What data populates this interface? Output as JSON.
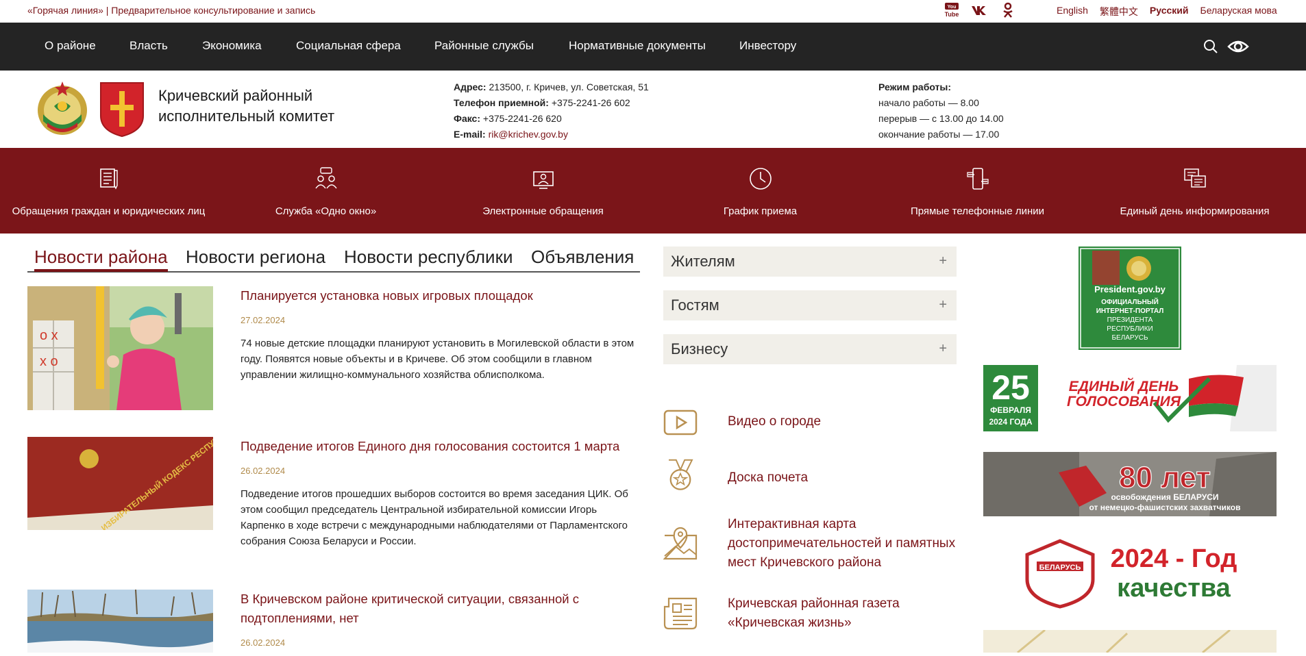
{
  "topbar": {
    "hotline": "«Горячая линия» | Предварительное консультирование и запись",
    "social": [
      "youtube-icon",
      "vk-icon",
      "odnoklassniki-icon"
    ],
    "languages": [
      {
        "label": "English",
        "active": false
      },
      {
        "label": "繁體中文",
        "active": false
      },
      {
        "label": "Русский",
        "active": true
      },
      {
        "label": "Беларуская мова",
        "active": false
      }
    ]
  },
  "nav": {
    "items": [
      "О районе",
      "Власть",
      "Экономика",
      "Социальная сфера",
      "Районные службы",
      "Нормативные документы",
      "Инвестору"
    ]
  },
  "header": {
    "org_name_1": "Кричевский районный",
    "org_name_2": "исполнительный комитет",
    "address_label": "Адрес:",
    "address": "213500, г. Кричев, ул. Советская, 51",
    "phone_label": "Телефон приемной:",
    "phone": "+375-2241-26 602",
    "fax_label": "Факс:",
    "fax": "+375-2241-26 620",
    "email_label": "E-mail:",
    "email": "rik@krichev.gov.by",
    "hours_title": "Режим работы:",
    "hours_1": "начало работы — 8.00",
    "hours_2": "перерыв — с 13.00 до 14.00",
    "hours_3": "окончание работы — 17.00"
  },
  "services": [
    {
      "label": "Обращения граждан и юридических лиц",
      "icon": "document-pen-icon"
    },
    {
      "label": "Служба «Одно окно»",
      "icon": "people-chat-icon"
    },
    {
      "label": "Электронные обращения",
      "icon": "computer-user-icon"
    },
    {
      "label": "График приема",
      "icon": "clock-icon"
    },
    {
      "label": "Прямые телефонные линии",
      "icon": "phone-icon"
    },
    {
      "label": "Единый день информирования",
      "icon": "info-cards-icon"
    }
  ],
  "news_tabs": [
    {
      "label": "Новости района",
      "active": true
    },
    {
      "label": "Новости региона",
      "active": false
    },
    {
      "label": "Новости республики",
      "active": false
    },
    {
      "label": "Объявления",
      "active": false
    }
  ],
  "news": [
    {
      "title": "Планируется установка новых игровых площадок",
      "date": "27.02.2024",
      "text": "74 новые детские площадки планируют установить в Могилевской области в этом году. Появятся новые объекты и в Кричеве. Об этом сообщили в главном управлении жилищно-коммунального хозяйства облисполкома."
    },
    {
      "title": "Подведение итогов Единого дня голосования состоится 1 марта",
      "date": "26.02.2024",
      "text": "Подведение итогов прошедших выборов состоится во время заседания ЦИК. Об этом сообщил председатель Центральной избирательной комиссии Игорь Карпенко в ходе встречи с международными наблюдателями от Парламентского собрания Союза Беларуси и России.",
      "book_text": "ИЗБИРАТЕЛЬНЫЙ КОДЕКС РЕСПУБЛИКИ БЕЛАРУСЬ"
    },
    {
      "title": "В Кричевском районе критической ситуации, связанной с подтоплениями, нет",
      "date": "26.02.2024",
      "text": ""
    }
  ],
  "accordion": [
    {
      "label": "Жителям",
      "icon": "plus-icon",
      "sign": "+"
    },
    {
      "label": "Гостям",
      "icon": "plus-icon",
      "sign": "+"
    },
    {
      "label": "Бизнесу",
      "icon": "plus-icon",
      "sign": "+"
    }
  ],
  "quick_links": [
    {
      "label": "Видео о городе",
      "icon": "video-play-icon"
    },
    {
      "label": "Доска почета",
      "icon": "medal-icon"
    },
    {
      "label": "Интерактивная карта достопримечательностей и памятных мест Кричевского района",
      "icon": "map-pin-icon"
    },
    {
      "label": "Кричевская районная газета «Кричевская жизнь»",
      "icon": "newspaper-icon"
    }
  ],
  "banners": {
    "president": {
      "line1": "President.gov.by",
      "line2": "ОФИЦИАЛЬНЫЙ",
      "line3": "ИНТЕРНЕТ-ПОРТАЛ",
      "line4": "ПРЕЗИДЕНТА",
      "line5": "РЕСПУБЛИКИ",
      "line6": "БЕЛАРУСЬ"
    },
    "vote": {
      "day": "25",
      "month": "ФЕВРАЛЯ",
      "year": "2024 ГОДА",
      "title1": "ЕДИНЫЙ ДЕНЬ",
      "title2": "ГОЛОСОВАНИЯ"
    },
    "liberation": {
      "big": "80 лет",
      "l1": "освобождения БЕЛАРУСИ",
      "l2": "от немецко-фашистских захватчиков"
    },
    "quality": {
      "badge": "БЕЛАРУСЬ",
      "l1": "2024 - Год",
      "l2": "качества"
    }
  },
  "colors": {
    "brand": "#7b1519",
    "nav": "#242424",
    "date": "#b08a4a",
    "accordion": "#f1efe9"
  }
}
